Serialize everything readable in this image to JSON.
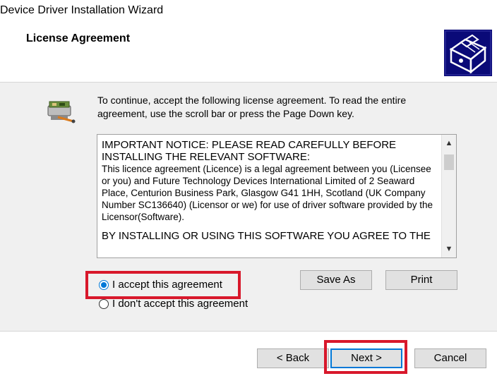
{
  "window": {
    "title": "Device Driver Installation Wizard"
  },
  "header": {
    "page_title": "License Agreement",
    "logo_icon": "installer-box-icon"
  },
  "instructions": {
    "icon": "license-agreement-icon",
    "text": "To continue, accept the following license agreement. To read the entire agreement, use the scroll bar or press the Page Down key."
  },
  "license": {
    "heading": "IMPORTANT NOTICE: PLEASE READ CAREFULLY BEFORE INSTALLING THE RELEVANT SOFTWARE:",
    "body": "This licence agreement (Licence) is a legal agreement between you (Licensee or you) and Future Technology Devices International Limited of 2 Seaward Place, Centurion Business Park, Glasgow G41 1HH, Scotland (UK Company Number SC136640) (Licensor or we) for use of driver software provided by the Licensor(Software).",
    "last_line": "BY INSTALLING OR USING THIS SOFTWARE YOU AGREE TO THE",
    "scroll_up": "▲",
    "scroll_down": "▼"
  },
  "options": {
    "accept": {
      "label": "I accept this agreement",
      "selected": true
    },
    "decline": {
      "label": "I don't accept this agreement",
      "selected": false
    }
  },
  "buttons": {
    "save_as": "Save As",
    "print": "Print",
    "back": "< Back",
    "next": "Next >",
    "cancel": "Cancel"
  },
  "colors": {
    "highlight": "#d8182b",
    "accent": "#0078d7",
    "panel": "#f0f0f0"
  }
}
